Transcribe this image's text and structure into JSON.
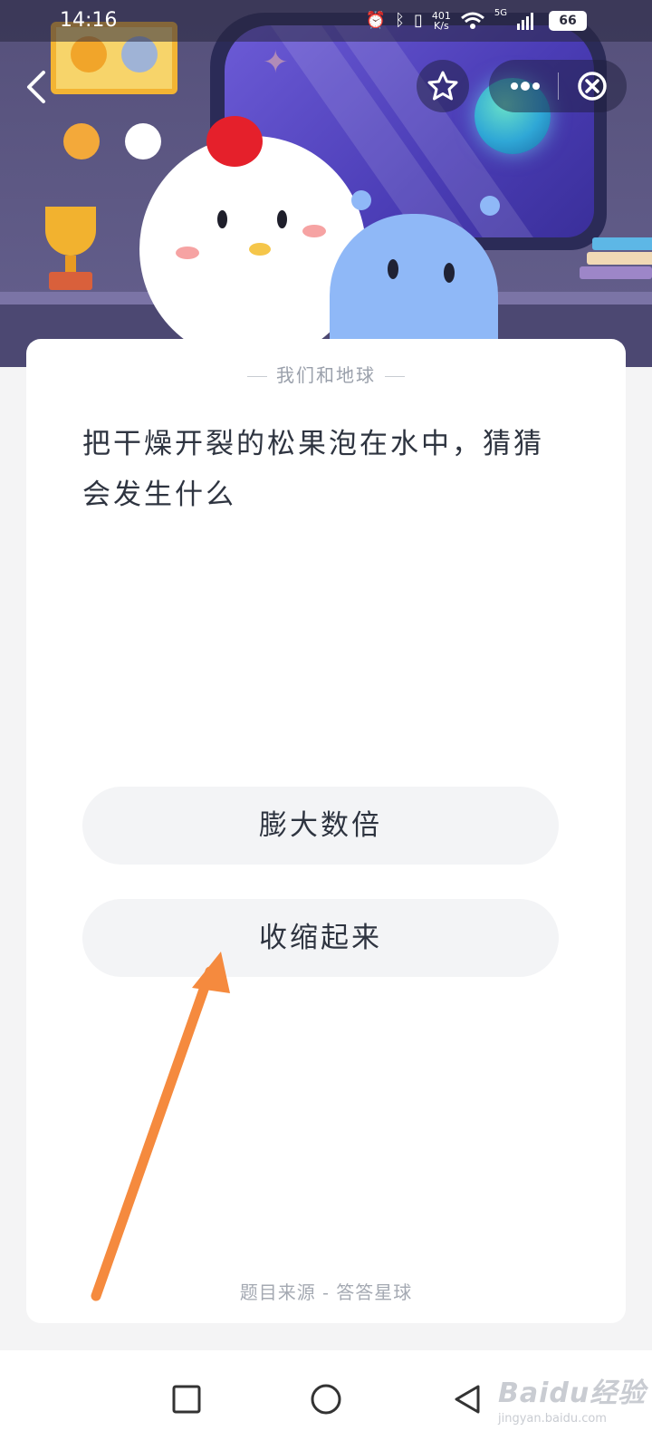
{
  "status_bar": {
    "time": "14:16",
    "network_speed": "401\nK/s",
    "network_type": "5G",
    "battery_level": "66",
    "icons": [
      "alarm-icon",
      "bluetooth-icon",
      "vibrate-icon",
      "wifi-icon",
      "signal-icon",
      "battery-icon"
    ]
  },
  "header": {
    "icons": [
      "back-icon",
      "star-icon",
      "more-icon",
      "close-icon"
    ],
    "colors": {
      "wall": "#5e5a82",
      "window": "#4b3db6"
    }
  },
  "quiz": {
    "category": "我们和地球",
    "question": "把干燥开裂的松果泡在水中，猜猜会发生什么",
    "options": [
      {
        "label": "膨大数倍"
      },
      {
        "label": "收缩起来"
      }
    ],
    "source": "题目来源 - 答答星球"
  },
  "annotation": {
    "color": "#f58a3e",
    "icon": "arrow-up-icon"
  },
  "nav_bar": {
    "icons": [
      "recents-icon",
      "home-icon",
      "back-triangle-icon"
    ],
    "watermark_logo": "Baidu经验",
    "watermark_url": "jingyan.baidu.com"
  }
}
